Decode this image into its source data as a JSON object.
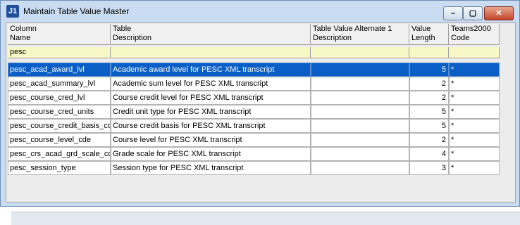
{
  "window": {
    "title": "Maintain Table Value Master",
    "app_icon_label": "J1",
    "buttons": {
      "minimize": "–",
      "maximize": "▢",
      "close": "✕"
    }
  },
  "grid": {
    "columns": [
      {
        "key": "column_name",
        "label": "Column\nName"
      },
      {
        "key": "table_description",
        "label": "Table\nDescription"
      },
      {
        "key": "alt1_description",
        "label": "Table Value Alternate 1\nDescription"
      },
      {
        "key": "value_length",
        "label": "Value\nLength"
      },
      {
        "key": "teams2000_code",
        "label": "Teams2000\nCode"
      }
    ],
    "filter": {
      "column_name": "pesc",
      "table_description": "",
      "alt1_description": "",
      "value_length": "",
      "teams2000_code": ""
    },
    "selected_row": 0,
    "rows": [
      {
        "column_name": "pesc_acad_award_lvl",
        "table_description": "Academic award level for PESC XML transcript",
        "alt1_description": "",
        "value_length": "5",
        "teams2000_code": "*"
      },
      {
        "column_name": "pesc_acad_summary_lvl",
        "table_description": "Academic sum level for PESC XML transcript",
        "alt1_description": "",
        "value_length": "2",
        "teams2000_code": "*"
      },
      {
        "column_name": "pesc_course_cred_lvl",
        "table_description": "Course credit level for PESC XML transcript",
        "alt1_description": "",
        "value_length": "2",
        "teams2000_code": "*"
      },
      {
        "column_name": "pesc_course_cred_units",
        "table_description": "Credit unit type for PESC XML transcript",
        "alt1_description": "",
        "value_length": "5",
        "teams2000_code": "*"
      },
      {
        "column_name": "pesc_course_credit_basis_cde",
        "table_description": "Course credit basis for PESC XML transcript",
        "alt1_description": "",
        "value_length": "5",
        "teams2000_code": "*"
      },
      {
        "column_name": "pesc_course_level_cde",
        "table_description": "Course level for PESC XML transcript",
        "alt1_description": "",
        "value_length": "2",
        "teams2000_code": "*"
      },
      {
        "column_name": "pesc_crs_acad_grd_scale_cde",
        "table_description": "Grade scale for PESC XML transcript",
        "alt1_description": "",
        "value_length": "4",
        "teams2000_code": "*"
      },
      {
        "column_name": "pesc_session_type",
        "table_description": "Session type for PESC XML transcript",
        "alt1_description": "",
        "value_length": "3",
        "teams2000_code": "*"
      }
    ]
  },
  "colors": {
    "selection": "#0a5fc6",
    "filter_row": "#f7f8c6",
    "window_frame": "#c9dcf1"
  }
}
